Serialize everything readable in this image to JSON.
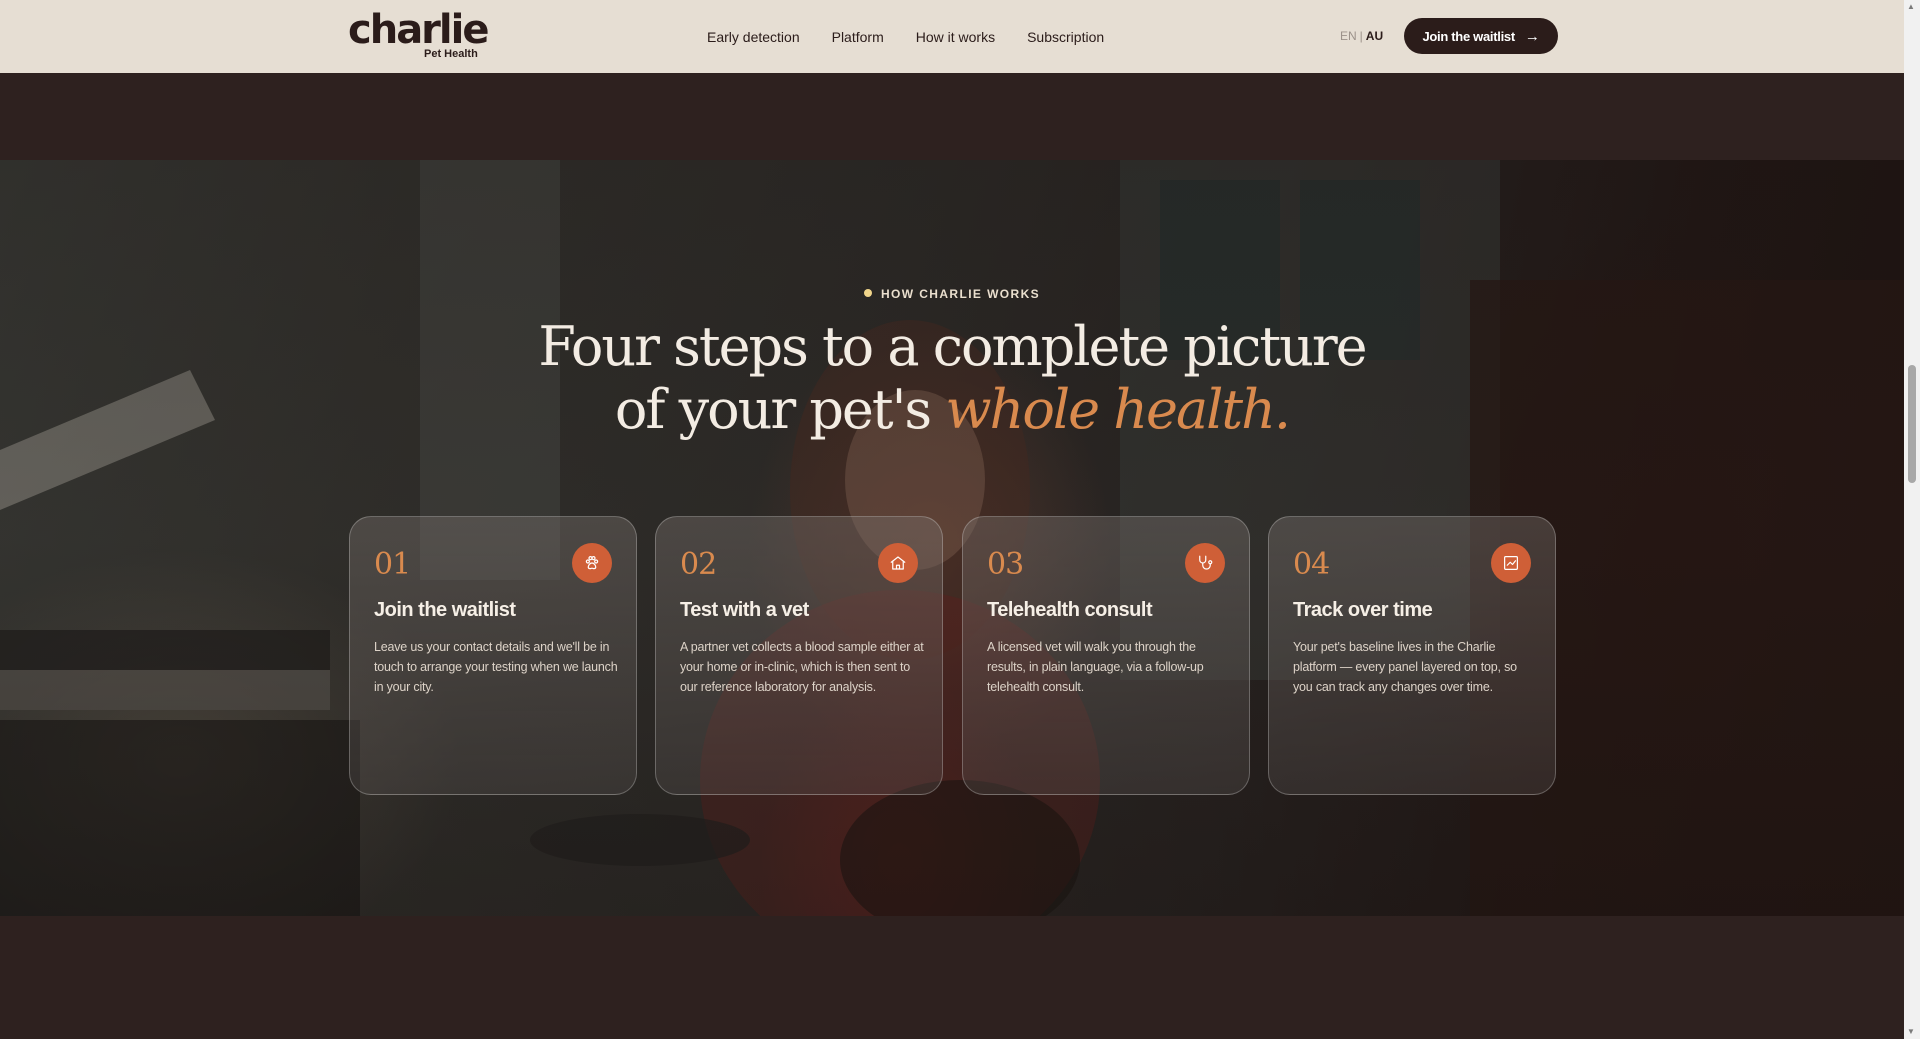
{
  "header": {
    "logo_word": "charlie",
    "logo_sub": "Pet Health",
    "nav": [
      "Early detection",
      "Platform",
      "How it works",
      "Subscription"
    ],
    "lang_en": "EN",
    "lang_sep": "|",
    "lang_au": "AU",
    "cta_label": "Join the waitlist",
    "cta_arrow": "→"
  },
  "section": {
    "eyebrow": "HOW CHARLIE WORKS",
    "headline_line1": "Four steps to a complete picture",
    "headline_line2_plain": "of your pet's ",
    "headline_line2_accent": "whole health."
  },
  "steps": [
    {
      "num": "01",
      "icon": "paw-icon",
      "title": "Join the waitlist",
      "desc": "Leave us your contact details and we'll be in touch to arrange your testing when we launch in your city."
    },
    {
      "num": "02",
      "icon": "home-icon",
      "title": "Test with a vet",
      "desc": "A partner vet collects a blood sample either at your home or in-clinic, which is then sent to our reference laboratory for analysis."
    },
    {
      "num": "03",
      "icon": "stethoscope-icon",
      "title": "Telehealth consult",
      "desc": "A licensed vet will walk you through the results, in plain language, via a follow-up telehealth consult."
    },
    {
      "num": "04",
      "icon": "chart-icon",
      "title": "Track over time",
      "desc": "Your pet's baseline lives in the Charlie platform — every panel layered on top, so you can track any changes over time."
    }
  ],
  "colors": {
    "accent": "#d98a4e",
    "icon_bg": "#cf5f37",
    "header_bg": "#e6ded3",
    "page_bg": "#2e211f",
    "cta_bg": "#2b1c1a"
  }
}
